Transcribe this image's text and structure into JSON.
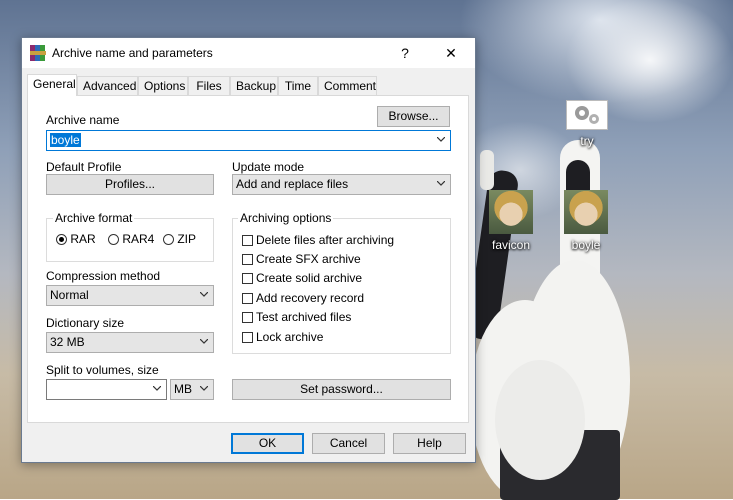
{
  "desktop": {
    "icons": [
      {
        "label": "try",
        "icon": "gears-icon"
      },
      {
        "label": "favicon",
        "icon": "anime-avatar-icon"
      },
      {
        "label": "boyle",
        "icon": "anime-avatar-icon"
      }
    ]
  },
  "dialog": {
    "title": "Archive name and parameters",
    "help_glyph": "?",
    "close_glyph": "✕",
    "tabs": [
      "General",
      "Advanced",
      "Options",
      "Files",
      "Backup",
      "Time",
      "Comment"
    ],
    "active_tab": "General",
    "archive_name": {
      "label": "Archive name",
      "value": "boyle",
      "browse_label": "Browse..."
    },
    "default_profile": {
      "label": "Default Profile",
      "button_label": "Profiles..."
    },
    "update_mode": {
      "label": "Update mode",
      "value": "Add and replace files"
    },
    "archive_format": {
      "label": "Archive format",
      "options": [
        "RAR",
        "RAR4",
        "ZIP"
      ],
      "selected": "RAR"
    },
    "compression_method": {
      "label": "Compression method",
      "value": "Normal"
    },
    "dictionary_size": {
      "label": "Dictionary size",
      "value": "32 MB"
    },
    "split_volumes": {
      "label": "Split to volumes, size",
      "value": "",
      "unit": "MB"
    },
    "archiving_options": {
      "label": "Archiving options",
      "items": [
        {
          "label": "Delete files after archiving",
          "checked": false
        },
        {
          "label": "Create SFX archive",
          "checked": false
        },
        {
          "label": "Create solid archive",
          "checked": false
        },
        {
          "label": "Add recovery record",
          "checked": false
        },
        {
          "label": "Test archived files",
          "checked": false
        },
        {
          "label": "Lock archive",
          "checked": false
        }
      ]
    },
    "set_password_label": "Set password...",
    "buttons": {
      "ok": "OK",
      "cancel": "Cancel",
      "help": "Help"
    }
  },
  "colors": {
    "accent": "#0078d7",
    "dialog_bg": "#f0f0f0",
    "panel_bg": "#ffffff"
  }
}
